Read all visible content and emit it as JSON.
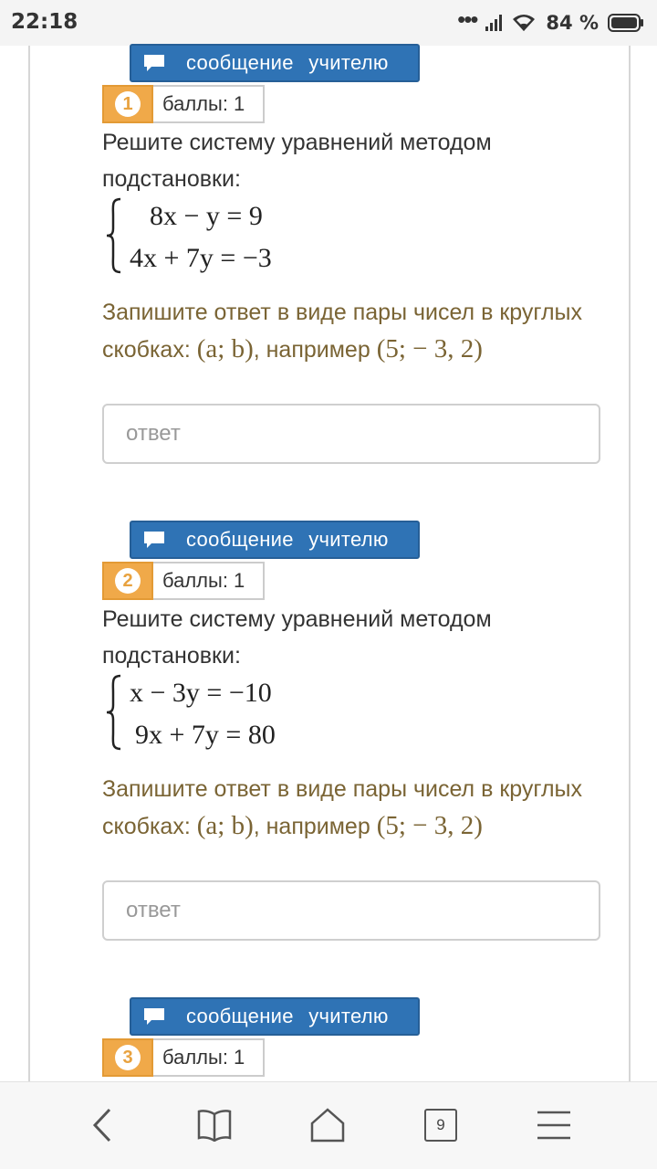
{
  "status_bar": {
    "time": "22:18",
    "battery": "84 %"
  },
  "tasks": [
    {
      "number": "1",
      "score": "баллы: 1",
      "message_button": "сообщение учителю",
      "question": "Решите систему уравнений методом подстановки:",
      "equations": [
        "8x − y = 9",
        "4x + 7y = −3"
      ],
      "hint_prefix": "Запишите ответ в виде пары чисел в круглых скобках:",
      "hint_format": "(a; b)",
      "hint_middle": ", например",
      "hint_example": "(5;  − 3, 2)",
      "answer_placeholder": "ответ",
      "answer_value": ""
    },
    {
      "number": "2",
      "score": "баллы: 1",
      "message_button": "сообщение учителю",
      "question": "Решите систему уравнений методом подстановки:",
      "equations": [
        "x − 3y = −10",
        "9x + 7y = 80"
      ],
      "hint_prefix": "Запишите ответ в виде пары чисел в круглых скобках:",
      "hint_format": "(a; b)",
      "hint_middle": ", например",
      "hint_example": "(5;  − 3, 2)",
      "answer_placeholder": "ответ",
      "answer_value": ""
    },
    {
      "number": "3",
      "score": "баллы: 1",
      "message_button": "сообщение учителю"
    }
  ],
  "bottom_nav": {
    "tab_count": "9",
    "icons": [
      "back-icon",
      "bookmarks-icon",
      "home-icon",
      "tabs-icon",
      "menu-icon"
    ]
  },
  "colors": {
    "accent_blue": "#2f73b5",
    "task_badge": "#f0a949",
    "hint_text": "#7a6434"
  }
}
